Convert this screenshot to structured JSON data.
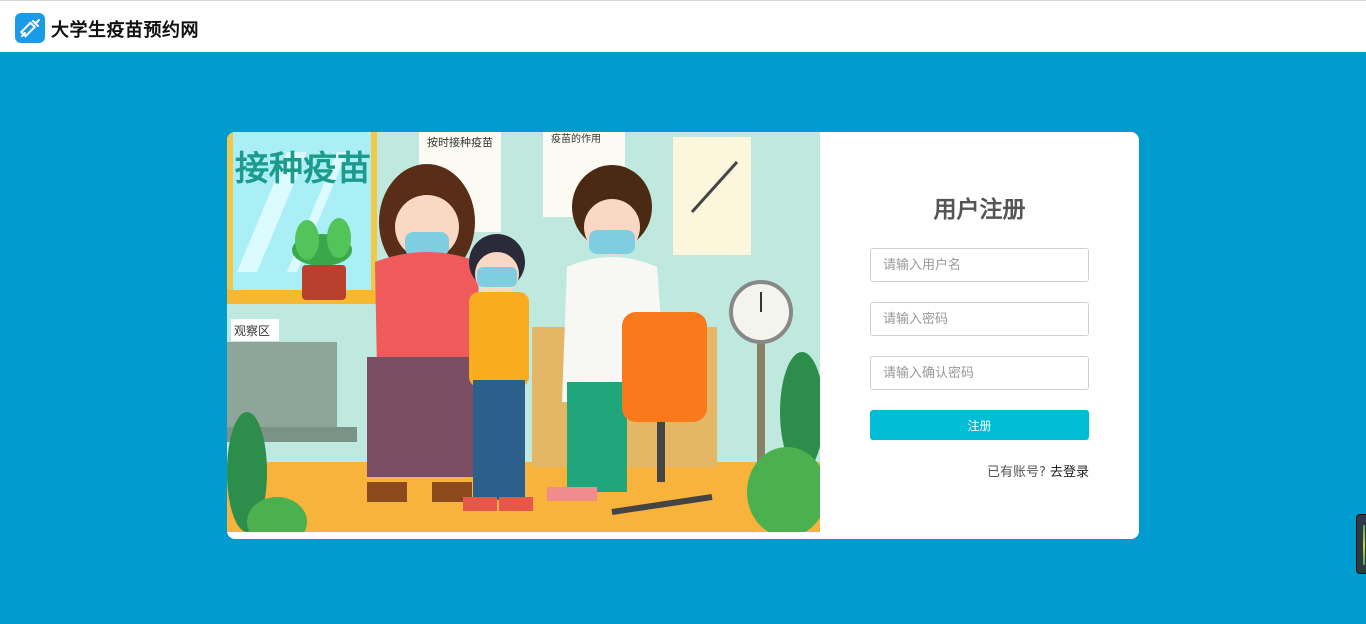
{
  "header": {
    "site_title": "大学生疫苗预约网",
    "logo_icon": "syringe-icon"
  },
  "illustration": {
    "banner_text": "接种疫苗",
    "sign_text": "观察区",
    "poster_text_1": "按时接种疫苗",
    "poster_text_2": "疫苗的作用"
  },
  "register": {
    "title": "用户注册",
    "username_placeholder": "请输入用户名",
    "password_placeholder": "请输入密码",
    "confirm_placeholder": "请输入确认密码",
    "submit_label": "注册",
    "have_account_text": "已有账号?",
    "login_link": "去登录"
  },
  "colors": {
    "page_bg": "#019ccf",
    "button": "#00bcd4",
    "logo": "#1a9be9"
  }
}
